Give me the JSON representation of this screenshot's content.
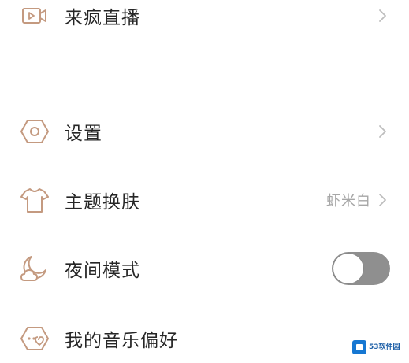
{
  "menu": {
    "items": [
      {
        "id": "live",
        "label": "来疯直播",
        "icon": "video-camera-icon",
        "has_chevron": true
      },
      {
        "id": "settings",
        "label": "设置",
        "icon": "hexagon-gear-icon",
        "has_chevron": true
      },
      {
        "id": "theme",
        "label": "主题换肤",
        "icon": "tshirt-icon",
        "value": "虾米白",
        "has_chevron": true
      },
      {
        "id": "night",
        "label": "夜间模式",
        "icon": "moon-cloud-icon",
        "toggle": false
      },
      {
        "id": "music_pref",
        "label": "我的音乐偏好",
        "icon": "hexagon-heart-icon",
        "has_chevron": false
      }
    ]
  },
  "colors": {
    "icon_stroke": "#c49a80",
    "label": "#262626",
    "value": "#a7a7a7",
    "chevron": "#bdbdbd",
    "toggle_off": "#8f8f8f",
    "watermark_blue": "#1677d2"
  },
  "watermark": {
    "text": "53软件园"
  }
}
